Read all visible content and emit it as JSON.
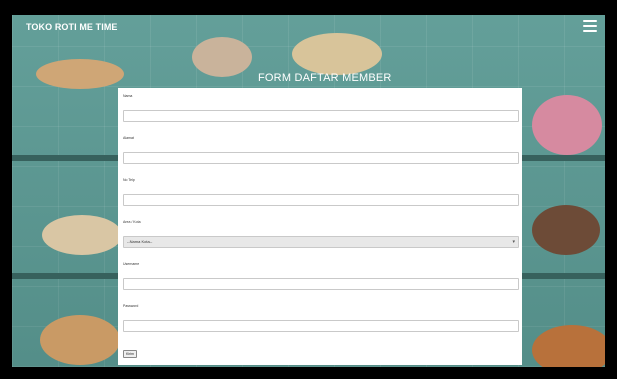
{
  "navbar": {
    "brand": "TOKO ROTI ME TIME"
  },
  "form": {
    "title": "FORM DAFTAR MEMBER",
    "fields": [
      {
        "label": "Nama",
        "value": ""
      },
      {
        "label": "Alamat",
        "value": ""
      },
      {
        "label": "No Telp",
        "value": ""
      },
      {
        "label": "Area / Kota",
        "selected": "--Nama Kota--"
      },
      {
        "label": "Username",
        "value": ""
      },
      {
        "label": "Password",
        "value": ""
      }
    ],
    "submit_label": "Kirim"
  },
  "colors": {
    "card": "#ffffff",
    "accent": "#5b9a94",
    "frame": "#000000"
  },
  "icons": {
    "menu": "hamburger-icon",
    "select": "chevron-down-icon"
  }
}
